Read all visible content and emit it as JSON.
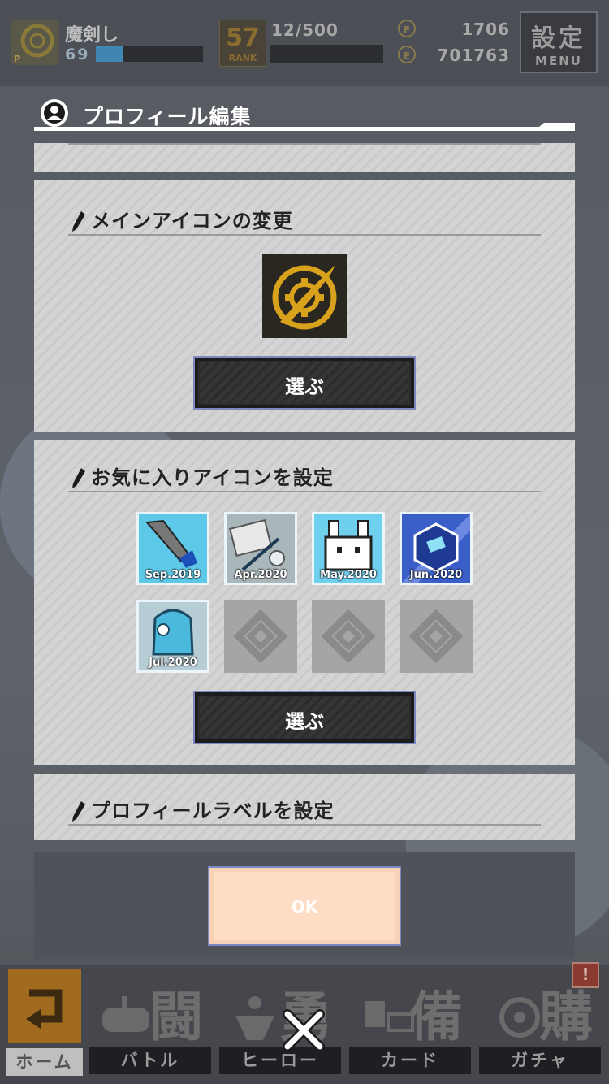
{
  "player": {
    "name": "魔剣し",
    "level": "69",
    "xp_progress": 0.25,
    "rank_number": "57",
    "rank_label": "RANK",
    "rank_progress": "12/500",
    "currency_1": "1706",
    "currency_2": "701763",
    "currency_1_symbol": "F",
    "currency_2_symbol": "E"
  },
  "menu": {
    "kanji": "設定",
    "label": "MENU"
  },
  "dialog": {
    "title": "プロフィール編集",
    "sections": {
      "main_icon": {
        "title": "メインアイコンの変更",
        "button": "選ぶ"
      },
      "favorite_icons": {
        "title": "お気に入りアイコンを設定",
        "button": "選ぶ",
        "items": [
          {
            "label": "Sep.2019",
            "icon": "sword-icon",
            "filled": true
          },
          {
            "label": "Apr.2020",
            "icon": "letter-flower-icon",
            "filled": true
          },
          {
            "label": "May.2020",
            "icon": "rabbit-icon",
            "filled": true
          },
          {
            "label": "Jun.2020",
            "icon": "gem-icon",
            "filled": true
          },
          {
            "label": "Jul.2020",
            "icon": "backpack-icon",
            "filled": true
          },
          {
            "label": "",
            "icon": "empty-slot-icon",
            "filled": false
          },
          {
            "label": "",
            "icon": "empty-slot-icon",
            "filled": false
          },
          {
            "label": "",
            "icon": "empty-slot-icon",
            "filled": false
          }
        ]
      },
      "profile_label": {
        "title": "プロフィールラベルを設定"
      }
    },
    "ok_button": "OK"
  },
  "nav": {
    "home": "ホーム",
    "battle": {
      "label": "バトル",
      "kanji": "闘"
    },
    "hero": {
      "label": "ヒーロー",
      "kanji": "勇"
    },
    "card": {
      "label": "カード",
      "kanji": "備"
    },
    "gacha": {
      "label": "ガチャ",
      "kanji": "購"
    },
    "badge": "!"
  },
  "colors": {
    "accent_gold": "#d9a21c",
    "button_border": "#7d88c2",
    "ok_bg": "#ffdcc4"
  }
}
